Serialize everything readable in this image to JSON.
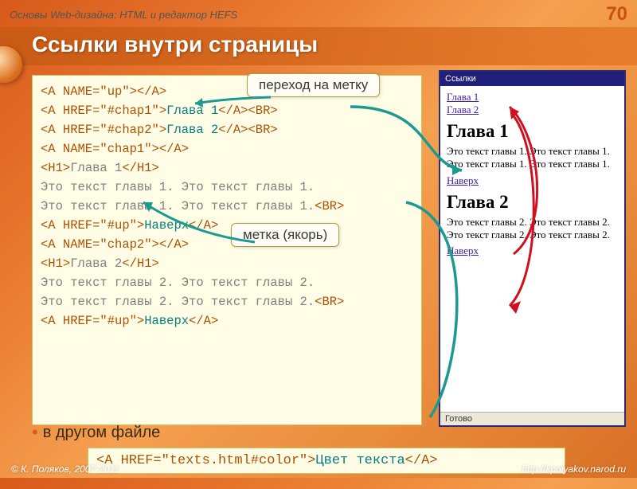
{
  "header": {
    "course": "Основы Web-дизайна: HTML и редактор HEFS",
    "page_number": "70"
  },
  "title": "Ссылки внутри страницы",
  "callouts": {
    "goto_anchor": "переход на метку",
    "anchor": "метка (якорь)"
  },
  "code_main": {
    "l1a": "<A NAME=\"up\">",
    "l1b": "</A>",
    "l2a": "<A HREF=\"#chap1\">",
    "l2b": "Глава 1",
    "l2c": "</A><BR>",
    "l3a": "<A HREF=\"#chap2\">",
    "l3b": "Глава 2",
    "l3c": "</A><BR>",
    "l4a": "<A NAME=\"chap1\">",
    "l4b": "</A>",
    "l5a": "<H1>",
    "l5b": "Глава 1",
    "l5c": "</H1>",
    "l6": "Это текст главы 1. Это текст главы 1.",
    "l7": "Это текст главы 1. Это текст главы 1.",
    "l7b": "<BR>",
    "l8a": "<A HREF=\"#up\">",
    "l8b": "Наверх",
    "l8c": "</A>",
    "l9a": "<A NAME=\"chap2\">",
    "l9b": "</A>",
    "l10a": "<H1>",
    "l10b": "Глава 2",
    "l10c": "</H1>",
    "l11": "Это текст главы 2. Это текст главы 2.",
    "l12": "Это текст главы 2. Это текст главы 2.",
    "l12b": "<BR>",
    "l13a": "<A HREF=\"#up\">",
    "l13b": "Наверх",
    "l13c": "</A>"
  },
  "bullet": "в другом файле",
  "code_ext": {
    "a": "<A HREF=\"texts.html#color\">",
    "b": "Цвет текста",
    "c": "</A>"
  },
  "preview": {
    "title": "Ссылки",
    "link1": "Глава 1",
    "link2": "Глава 2",
    "h1": "Глава 1",
    "p1": "Это текст главы 1. Это текст главы 1. Это текст главы 1. Это текст главы 1.",
    "up1": "Наверх",
    "h2": "Глава 2",
    "p2": "Это текст главы 2. Это текст главы 2. Это текст главы 2. Это текст главы 2.",
    "up2": "Наверх",
    "status": "Готово"
  },
  "footer": {
    "copyright": "© К. Поляков, 2007-2011",
    "url": "http://kpolyakov.narod.ru"
  }
}
